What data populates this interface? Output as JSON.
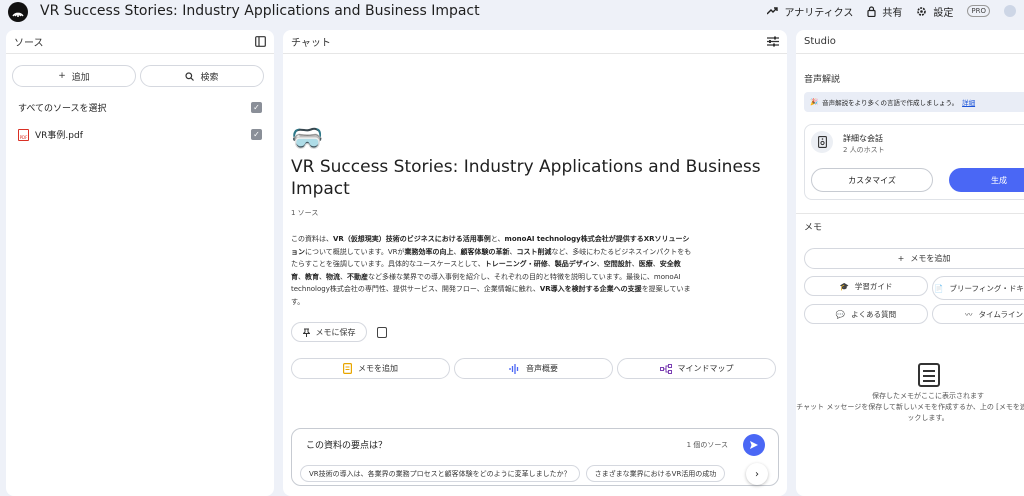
{
  "header": {
    "title": "VR Success Stories: Industry Applications and Business Impact",
    "analytics_label": "アナリティクス",
    "share_label": "共有",
    "settings_label": "設定",
    "pro_badge": "PRO"
  },
  "sources": {
    "title": "ソース",
    "add_label": "追加",
    "search_label": "検索",
    "select_all_label": "すべてのソースを選択",
    "items": [
      {
        "name": "VR事例.pdf"
      }
    ]
  },
  "chat": {
    "title": "チャット",
    "doc_emoji": "🥽",
    "doc_title": "VR Success Stories: Industry Applications and Business Impact",
    "source_count": "1 ソース",
    "summary": [
      {
        "t": "この資料は、",
        "b": false
      },
      {
        "t": "VR（仮想現実）技術のビジネスにおける活用事例",
        "b": true
      },
      {
        "t": "と、",
        "b": false
      },
      {
        "t": "monoAI technology株式会社が提供するXRソリューション",
        "b": true
      },
      {
        "t": "について概説しています。VRが",
        "b": false
      },
      {
        "t": "業務効率の向上",
        "b": true
      },
      {
        "t": "、",
        "b": false
      },
      {
        "t": "顧客体験の革新",
        "b": true
      },
      {
        "t": "、",
        "b": false
      },
      {
        "t": "コスト削減",
        "b": true
      },
      {
        "t": "など、多岐にわたるビジネスインパクトをもたらすことを強調しています。具体的なユースケースとして、",
        "b": false
      },
      {
        "t": "トレーニング・研修",
        "b": true
      },
      {
        "t": "、",
        "b": false
      },
      {
        "t": "製品デザイン",
        "b": true
      },
      {
        "t": "、",
        "b": false
      },
      {
        "t": "空間設計",
        "b": true
      },
      {
        "t": "、",
        "b": false
      },
      {
        "t": "医療",
        "b": true
      },
      {
        "t": "、",
        "b": false
      },
      {
        "t": "安全教育",
        "b": true
      },
      {
        "t": "、",
        "b": false
      },
      {
        "t": "教育",
        "b": true
      },
      {
        "t": "、",
        "b": false
      },
      {
        "t": "物流",
        "b": true
      },
      {
        "t": "、",
        "b": false
      },
      {
        "t": "不動産",
        "b": true
      },
      {
        "t": "など多様な業界での導入事例を紹介し、それぞれの目的と特徴を説明しています。最後に、monoAI technology株式会社の専門性、提供サービス、開発フロー、企業情報に触れ、",
        "b": false
      },
      {
        "t": "VR導入を検討する企業への支援",
        "b": true
      },
      {
        "t": "を提案しています。",
        "b": false
      }
    ],
    "save_note_label": "メモに保存",
    "actions": [
      {
        "label": "メモを追加",
        "icon": "note-icon"
      },
      {
        "label": "音声概要",
        "icon": "audio-wave-icon"
      },
      {
        "label": "マインドマップ",
        "icon": "mindmap-icon"
      }
    ],
    "input_value": "この資料の要点は？",
    "input_source_count": "1 個のソース",
    "suggestions": [
      "VR技術の導入は、各業界の業務プロセスと顧客体験をどのように変革しましたか？",
      "さまざまな業界におけるVR活用の成功"
    ]
  },
  "studio": {
    "title": "Studio",
    "audio_section": "音声解説",
    "banner_text": "音声解説をより多くの言語で作成しましょう。",
    "banner_link": "詳細",
    "audio_card": {
      "name": "詳細な会話",
      "sub": "2 人のホスト",
      "customize_label": "カスタマイズ",
      "generate_label": "生成"
    },
    "memo_section": "メモ",
    "memo_add_label": "メモを追加",
    "memo_buttons": [
      {
        "label": "学習ガイド",
        "icon": "graduation-cap-icon"
      },
      {
        "label": "ブリーフィング・ドキュメント",
        "icon": "document-icon"
      },
      {
        "label": "よくある質問",
        "icon": "faq-icon"
      },
      {
        "label": "タイムライン",
        "icon": "timeline-icon"
      }
    ],
    "empty_line1": "保存したメモがここに表示されます",
    "empty_line2": "チャット メッセージを保存して新しいメモを作成するか、上の [メモを追加] をクリックします。"
  },
  "colors": {
    "accent": "#4a67f5",
    "background": "#eef1f8",
    "link": "#1a53d9"
  }
}
